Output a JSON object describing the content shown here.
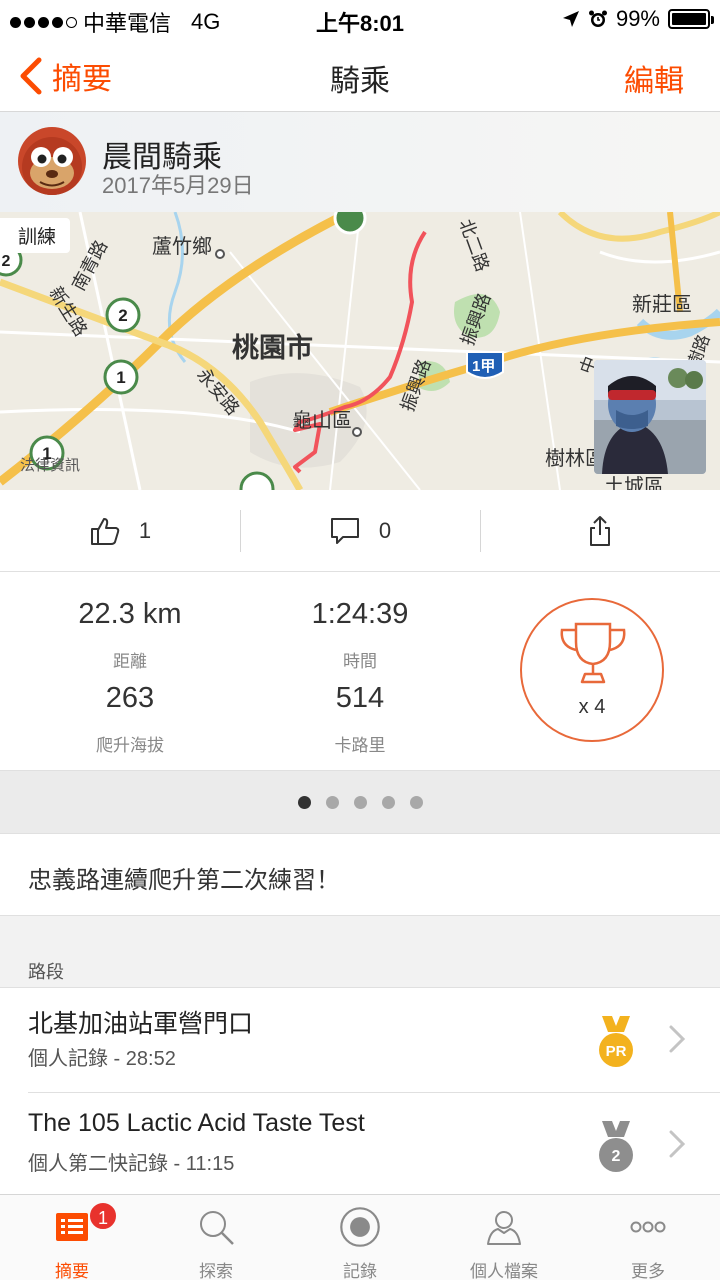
{
  "status_bar": {
    "carrier": "中華電信",
    "network": "4G",
    "time": "上午8:01",
    "battery": "99%"
  },
  "nav": {
    "back_label": "摘要",
    "title": "騎乘",
    "edit_label": "編輯"
  },
  "athlete": {
    "activity_name": "晨間騎乘",
    "date": "2017年5月29日"
  },
  "map": {
    "tag": "訓練",
    "credit": "法律資訊",
    "labels": {
      "luzhu": "蘆竹鄉",
      "taoyuan": "桃園市",
      "guishan": "龜山區",
      "xinzhuang": "新莊區",
      "shulin": "樹林區",
      "tucheng": "土城區",
      "nanqing": "南青路",
      "xinsheng": "新生路",
      "yongan": "永安路",
      "zhenxing1": "振興路",
      "zhenxing2": "振興路",
      "route1": "1甲",
      "north2": "北二路",
      "shu": "中",
      "shulu": "樹路"
    },
    "markers": [
      "2",
      "1",
      "1",
      "2"
    ]
  },
  "social": {
    "kudos_count": "1",
    "comment_count": "0"
  },
  "stats": {
    "distance_value": "22.3 km",
    "distance_label": "距離",
    "time_value": "1:24:39",
    "time_label": "時間",
    "elevation_value": "263",
    "elevation_label": "爬升海拔",
    "calories_value": "514",
    "calories_label": "卡路里",
    "achievements": "x 4"
  },
  "pager": {
    "total": 5,
    "active": 1
  },
  "description": "忠義路連續爬升第二次練習！",
  "segments": {
    "header": "路段",
    "items": [
      {
        "name": "北基加油站軍營門口",
        "detail": "個人記錄 - 28:52",
        "medal": "PR"
      },
      {
        "name": "The 105 Lactic Acid Taste Test",
        "detail": "個人第二快記錄 - 11:15",
        "medal": "2"
      }
    ]
  },
  "tab_bar": {
    "items": [
      {
        "label": "摘要",
        "icon": "feed-icon",
        "badge": "1"
      },
      {
        "label": "探索",
        "icon": "search-icon"
      },
      {
        "label": "記錄",
        "icon": "record-icon"
      },
      {
        "label": "個人檔案",
        "icon": "profile-icon"
      },
      {
        "label": "更多",
        "icon": "more-icon"
      }
    ]
  },
  "colors": {
    "accent": "#fc4c02",
    "route": "#f1535b",
    "badge": "#e8322d"
  }
}
